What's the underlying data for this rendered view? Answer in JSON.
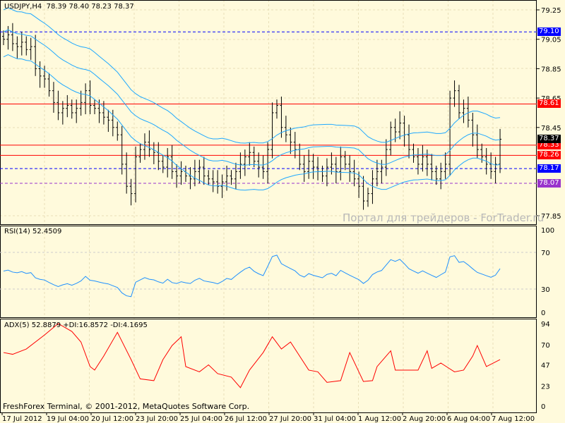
{
  "header": {
    "symbol": "USDJPY,H4",
    "ohlc": "78.39 78.40 78.23 78.37"
  },
  "price_axis": [
    "79.25",
    "79.05",
    "78.85",
    "78.65",
    "78.45",
    "77.85"
  ],
  "levels": [
    {
      "label": "79.10",
      "color": "#0000ff",
      "style": "dashed"
    },
    {
      "label": "78.61",
      "color": "#ff0000",
      "style": "solid"
    },
    {
      "label": "78.33",
      "color": "#ff0000",
      "style": "solid"
    },
    {
      "label": "78.26",
      "color": "#ff0000",
      "style": "solid"
    },
    {
      "label": "78.17",
      "color": "#0000ff",
      "style": "dashed"
    },
    {
      "label": "78.07",
      "color": "#9933cc",
      "style": "dashed"
    }
  ],
  "current_price": "78.37",
  "watermark": "Портал для трейдеров - ForTrader.ru",
  "closes": [
    79.05,
    79.08,
    79.02,
    79.0,
    79.03,
    78.98,
    79.0,
    78.85,
    78.8,
    78.78,
    78.7,
    78.62,
    78.55,
    78.58,
    78.6,
    78.55,
    78.58,
    78.62,
    78.7,
    78.6,
    78.58,
    78.55,
    78.52,
    78.5,
    78.45,
    78.4,
    78.2,
    78.05,
    78.0,
    78.25,
    78.3,
    78.35,
    78.3,
    78.28,
    78.22,
    78.18,
    78.25,
    78.15,
    78.12,
    78.15,
    78.12,
    78.1,
    78.15,
    78.18,
    78.12,
    78.1,
    78.08,
    78.05,
    78.08,
    78.12,
    78.1,
    78.15,
    78.2,
    78.25,
    78.28,
    78.22,
    78.18,
    78.15,
    78.3,
    78.55,
    78.6,
    78.45,
    78.4,
    78.35,
    78.3,
    78.2,
    78.15,
    78.22,
    78.18,
    78.15,
    78.12,
    78.18,
    78.2,
    78.15,
    78.25,
    78.2,
    78.15,
    78.1,
    78.05,
    77.95,
    78.0,
    78.1,
    78.15,
    78.18,
    78.3,
    78.45,
    78.42,
    78.48,
    78.4,
    78.3,
    78.25,
    78.2,
    78.25,
    78.2,
    78.15,
    78.1,
    78.15,
    78.2,
    78.65,
    78.7,
    78.55,
    78.58,
    78.5,
    78.4,
    78.3,
    78.25,
    78.2,
    78.15,
    78.2,
    78.37
  ],
  "rsi": {
    "label": "RSI(14) 52.4509",
    "axis": [
      "100",
      "70",
      "30",
      "0"
    ]
  },
  "adx": {
    "label": "ADX(5) 52.8879 +DI:16.8572 -DI:4.1695",
    "axis": [
      "94",
      "70",
      "47",
      "23",
      "0"
    ],
    "points": [
      [
        0,
        61
      ],
      [
        2,
        59
      ],
      [
        5,
        65
      ],
      [
        9,
        81
      ],
      [
        12,
        94
      ],
      [
        15,
        85
      ],
      [
        17,
        73
      ],
      [
        19,
        45
      ],
      [
        20,
        41
      ],
      [
        22,
        57
      ],
      [
        25,
        84
      ],
      [
        28,
        53
      ],
      [
        30,
        31
      ],
      [
        33,
        29
      ],
      [
        35,
        53
      ],
      [
        37,
        69
      ],
      [
        39,
        79
      ],
      [
        40,
        45
      ],
      [
        43,
        39
      ],
      [
        45,
        47
      ],
      [
        47,
        37
      ],
      [
        50,
        33
      ],
      [
        52,
        21
      ],
      [
        54,
        41
      ],
      [
        57,
        61
      ],
      [
        59,
        79
      ],
      [
        61,
        65
      ],
      [
        63,
        73
      ],
      [
        67,
        41
      ],
      [
        69,
        39
      ],
      [
        71,
        27
      ],
      [
        74,
        29
      ],
      [
        76,
        61
      ],
      [
        78,
        39
      ],
      [
        79,
        28
      ],
      [
        81,
        29
      ],
      [
        82,
        45
      ],
      [
        85,
        63
      ],
      [
        86,
        41
      ],
      [
        88,
        41
      ],
      [
        91,
        41
      ],
      [
        93,
        63
      ],
      [
        94,
        43
      ],
      [
        96,
        49
      ],
      [
        99,
        39
      ],
      [
        101,
        41
      ],
      [
        103,
        57
      ],
      [
        104,
        69
      ],
      [
        106,
        45
      ],
      [
        109,
        53
      ]
    ]
  },
  "copyright": "FreshForex Terminal, © 2001-2012, MetaQuotes Software Corp.",
  "time_axis": [
    "17 Jul 2012",
    "19 Jul 04:00",
    "20 Jul 12:00",
    "23 Jul 20:00",
    "25 Jul 04:00",
    "26 Jul 12:00",
    "27 Jul 20:00",
    "31 Jul 04:00",
    "1 Aug 12:00",
    "2 Aug 20:00",
    "6 Aug 04:00",
    "7 Aug 12:00"
  ]
}
